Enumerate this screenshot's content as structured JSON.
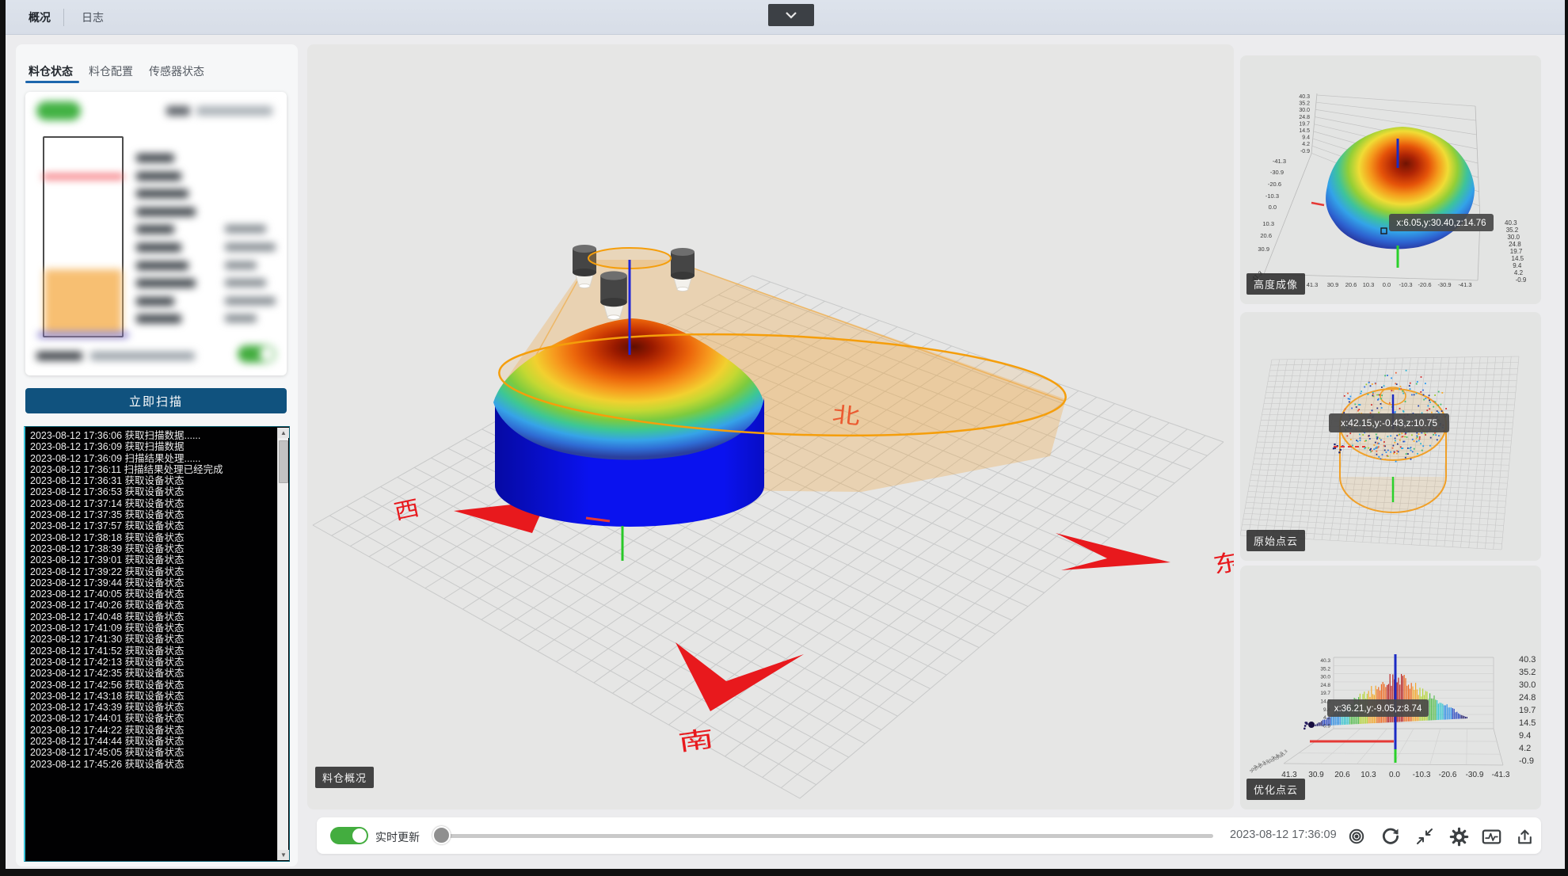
{
  "app": {
    "topbar": {
      "tabs": [
        "概况",
        "日志"
      ],
      "active_tab": "概况"
    }
  },
  "sidebar": {
    "tabs": [
      {
        "label": "料仓状态",
        "active": true
      },
      {
        "label": "料仓配置",
        "active": false
      },
      {
        "label": "传感器状态",
        "active": false
      }
    ],
    "status_card": {
      "redacted": true,
      "toggle_on": true
    },
    "scan_button": "立即扫描",
    "log_entries": [
      "2023-08-12 17:36:06 获取扫描数据......",
      "2023-08-12 17:36:09 获取扫描数据",
      "2023-08-12 17:36:09 扫描结果处理......",
      "2023-08-12 17:36:11 扫描结果处理已经完成",
      "2023-08-12 17:36:31 获取设备状态",
      "2023-08-12 17:36:53 获取设备状态",
      "2023-08-12 17:37:14 获取设备状态",
      "2023-08-12 17:37:35 获取设备状态",
      "2023-08-12 17:37:57 获取设备状态",
      "2023-08-12 17:38:18 获取设备状态",
      "2023-08-12 17:38:39 获取设备状态",
      "2023-08-12 17:39:01 获取设备状态",
      "2023-08-12 17:39:22 获取设备状态",
      "2023-08-12 17:39:44 获取设备状态",
      "2023-08-12 17:40:05 获取设备状态",
      "2023-08-12 17:40:26 获取设备状态",
      "2023-08-12 17:40:48 获取设备状态",
      "2023-08-12 17:41:09 获取设备状态",
      "2023-08-12 17:41:30 获取设备状态",
      "2023-08-12 17:41:52 获取设备状态",
      "2023-08-12 17:42:13 获取设备状态",
      "2023-08-12 17:42:35 获取设备状态",
      "2023-08-12 17:42:56 获取设备状态",
      "2023-08-12 17:43:18 获取设备状态",
      "2023-08-12 17:43:39 获取设备状态",
      "2023-08-12 17:44:01 获取设备状态",
      "2023-08-12 17:44:22 获取设备状态",
      "2023-08-12 17:44:44 获取设备状态",
      "2023-08-12 17:45:05 获取设备状态",
      "2023-08-12 17:45:26 获取设备状态"
    ]
  },
  "main_view": {
    "badge": "料仓概况",
    "compass": {
      "west": "西",
      "north": "北",
      "south": "南",
      "east": "东"
    }
  },
  "right_panels": [
    {
      "badge": "高度成像",
      "tooltip": "x:6.05,y:30.40,z:14.76",
      "z_ticks": [
        "40.3",
        "35.2",
        "30.0",
        "24.8",
        "19.7",
        "14.5",
        "9.4",
        "4.2",
        "-0.9"
      ],
      "y_ticks": [
        "-41.3",
        "-30.9",
        "-20.6",
        "-10.3",
        "0.0",
        "10.3",
        "20.6",
        "30.9"
      ],
      "corner_tick": "-41.3",
      "x_ticks": [
        "41.3",
        "30.9",
        "20.6",
        "10.3",
        "0.0",
        "-10.3",
        "-20.6",
        "-30.9",
        "-41.3"
      ]
    },
    {
      "badge": "原始点云",
      "tooltip": "x:42.15,y:-0.43,z:10.75"
    },
    {
      "badge": "优化点云",
      "tooltip": "x:36.21,y:-9.05,z:8.74",
      "z_ticks": [
        "40.3",
        "35.2",
        "30.0",
        "24.8",
        "19.7",
        "14.5",
        "9.4",
        "4.2",
        "-0.9"
      ],
      "y_ticks": [
        "30.9",
        "20.6",
        "10.3",
        "0.0",
        "-10.3",
        "-20.6",
        "-30.9",
        "-41.3"
      ],
      "x_ticks": [
        "41.3",
        "30.9",
        "20.6",
        "10.3",
        "0.0",
        "-10.3",
        "-20.6",
        "-30.9",
        "-41.3"
      ]
    }
  ],
  "bottom_bar": {
    "realtime_label": "实时更新",
    "realtime_on": true,
    "timestamp": "2023-08-12 17:36:09",
    "icons": [
      "locate",
      "refresh",
      "compress",
      "settings",
      "waveform",
      "export"
    ]
  },
  "colors": {
    "accent_blue": "#10527e",
    "tab_underline": "#1d66ad",
    "toggle_green": "#43ad3f",
    "scan_orange": "#f59e0b",
    "compass_red": "#e8191d"
  }
}
